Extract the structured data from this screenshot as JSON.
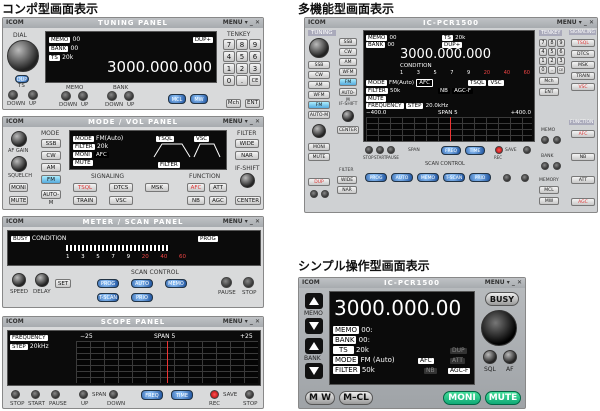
{
  "sections": {
    "combo": "コンポ型画面表示",
    "multi": "多機能型画面表示",
    "simple": "シンプル操作型画面表示"
  },
  "logo": "ICOM",
  "menu": "MENU ▾ _ ✕",
  "tuning": {
    "title": "TUNING PANEL",
    "dial": "DIAL",
    "dup": "DUP",
    "ts": "TS",
    "down": "DOWN",
    "up": "UP",
    "memo_lbl": "MEMO",
    "bank_lbl": "BANK",
    "memo": "MEMO",
    "memo_v": "00",
    "bank": "BANK",
    "bank_v": "00",
    "ts_tag": "TS",
    "ts_v": "20k",
    "dupplus": "DUP+",
    "freq": "3000.000.000",
    "mcl": "MCL",
    "mw": "MW",
    "tenkey": "TENKEY",
    "keys": [
      "7",
      "8",
      "9",
      "4",
      "5",
      "6",
      "1",
      "2",
      "3",
      "0",
      ".",
      "CE"
    ],
    "mch": "Mch",
    "ent": "ENT"
  },
  "mode": {
    "title": "MODE / VOL PANEL",
    "af": "AF GAIN",
    "sq": "SQUELCH",
    "moni": "MONI",
    "mute": "MUTE",
    "mode_lbl": "MODE",
    "ssb": "SSB",
    "cw": "CW",
    "am": "AM",
    "fm": "FM",
    "autom": "AUTO-M",
    "l_mode": "MODE",
    "v_mode": "FM(Auto)",
    "l_filter": "FILTER",
    "v_filter": "20k",
    "l_moni": "MONI",
    "l_mute": "MUTE",
    "afc": "AFC",
    "tsql": "TSQL",
    "vsc": "VSC",
    "filter_tag": "FILTER",
    "signaling": "SIGNALING",
    "s_tsql": "TSQL",
    "s_dtcs": "DTCS",
    "s_msk": "MSK",
    "s_train": "TRAIN",
    "s_vsc": "VSC",
    "function": "FUNCTION",
    "f_afc": "AFC",
    "f_att": "ATT",
    "f_nb": "NB",
    "f_agc": "AGC",
    "filter": "FILTER",
    "wide": "WIDE",
    "nar": "NAR",
    "ifshift": "IF-SHIFT",
    "center": "CENTER"
  },
  "meter": {
    "title": "METER / SCAN PANEL",
    "busy": "BUSY",
    "cond": "CONDITION",
    "prog": "PROG",
    "scale": [
      "1",
      "3",
      "5",
      "7",
      "9",
      "20",
      "40",
      "60"
    ],
    "speed": "SPEED",
    "delay": "DELAY",
    "set": "SET",
    "scanctl": "SCAN CONTROL",
    "prog_b": "PROG",
    "auto": "AUTO",
    "memo": "MEMO",
    "tscan": "T-SCAN",
    "prio": "PRIO",
    "pause": "PAUSE",
    "stop": "STOP"
  },
  "scope": {
    "title": "SCOPE PANEL",
    "freq_tag": "FREQUENCY",
    "step_tag": "STEP",
    "step_v": "20kHz",
    "left": "−25",
    "span": "SPAN 5",
    "right": "+25",
    "stop": "STOP",
    "start": "START",
    "pause": "PAUSE",
    "span_lbl": "SPAN",
    "up": "UP",
    "down": "DOWN",
    "freq": "FREQ",
    "time": "TIME",
    "rec": "REC",
    "save": "SAVE",
    "stop2": "STOP"
  },
  "multi": {
    "title": "IC-PCR1500",
    "tuning": "TUNING",
    "tenkey": "TENKEY",
    "signaling": "SIGNALING",
    "ssb": "SSB",
    "cw": "CW",
    "am": "AM",
    "wfm": "WFM",
    "fm": "FM",
    "autom": "AUTO-M",
    "moni": "MONI",
    "mute": "MUTE",
    "ifshift": "IF-SHIFT",
    "center": "CENTER",
    "dup": "DUP",
    "filter": "FILTER",
    "wide": "WIDE",
    "nar": "NAR",
    "memo": "MEMO",
    "memo_v": "00",
    "bank": "BANK",
    "bank_v": "00",
    "ts": "TS",
    "ts_v": "20k",
    "dupplus": "DUP+",
    "freq": "3000.000.000",
    "cond": "CONDITION",
    "scale": [
      "1",
      "3",
      "5",
      "7",
      "9",
      "20",
      "40",
      "60"
    ],
    "mode_tag": "MODE",
    "mode_v": "FM(Auto)",
    "filter_tag": "FILTER",
    "filter_v": "50k",
    "afc": "AFC",
    "tsql": "TSQL",
    "vsc": "VSC",
    "nb": "NB",
    "agc": "AGC-F",
    "mute_tag": "MUTE",
    "freq_tag": "FREQUENCY",
    "step_tag": "STEP",
    "step_v": "20.0kHz",
    "left": "−400.0",
    "span": "SPAN 5",
    "right": "+400.0",
    "stop": "STOP",
    "start": "START",
    "pause": "PAUSE",
    "span_lbl": "SPAN",
    "freq_b": "FREQ",
    "time": "TIME",
    "save": "SAVE",
    "rec": "REC",
    "scanctl": "SCAN CONTROL",
    "prog": "PROG",
    "auto": "AUTO",
    "memob": "MEMO",
    "tscan": "T-SCAN",
    "prio": "PRIO",
    "sig_tsql": "TSQL",
    "sig_dtcs": "DTCS",
    "sig_msk": "MSK",
    "sig_train": "TRAIN",
    "sig_vsc": "VSC",
    "mch": "Mch",
    "ent": "ENT",
    "memo_lbl": "MEMO",
    "bank_lbl": "BANK",
    "function": "FUNCTION",
    "afc_b": "AFC",
    "nb_b": "NB",
    "att": "ATT",
    "agc_b": "AGC",
    "memory": "MEMORY",
    "mcl": "MCL",
    "mw": "MW",
    "keys": [
      "7",
      "8",
      "9",
      "4",
      "5",
      "6",
      "1",
      "2",
      "3",
      "0",
      ".",
      "CE"
    ]
  },
  "simple": {
    "title": "IC-PCR1500",
    "memo": "MEMO",
    "bank": "BANK",
    "freq": "3000.000.00",
    "busy": "BUSY",
    "l_memo": "MEMO",
    "v_memo": "00:",
    "l_bank": "BANK",
    "v_bank": "00:",
    "l_ts": "TS",
    "v_ts": "20k",
    "dup": "DUP",
    "l_mode": "MODE",
    "v_mode": "FM (Auto)",
    "afc": "AFC",
    "att": "ATT",
    "l_filter": "FILTER",
    "v_filter": "50k",
    "nb": "NB",
    "agcf": "AGC-F",
    "sql": "SQL",
    "af": "AF",
    "mw": "M W",
    "mcl": "M–CL",
    "moni": "MONI",
    "mute": "MUTE"
  }
}
